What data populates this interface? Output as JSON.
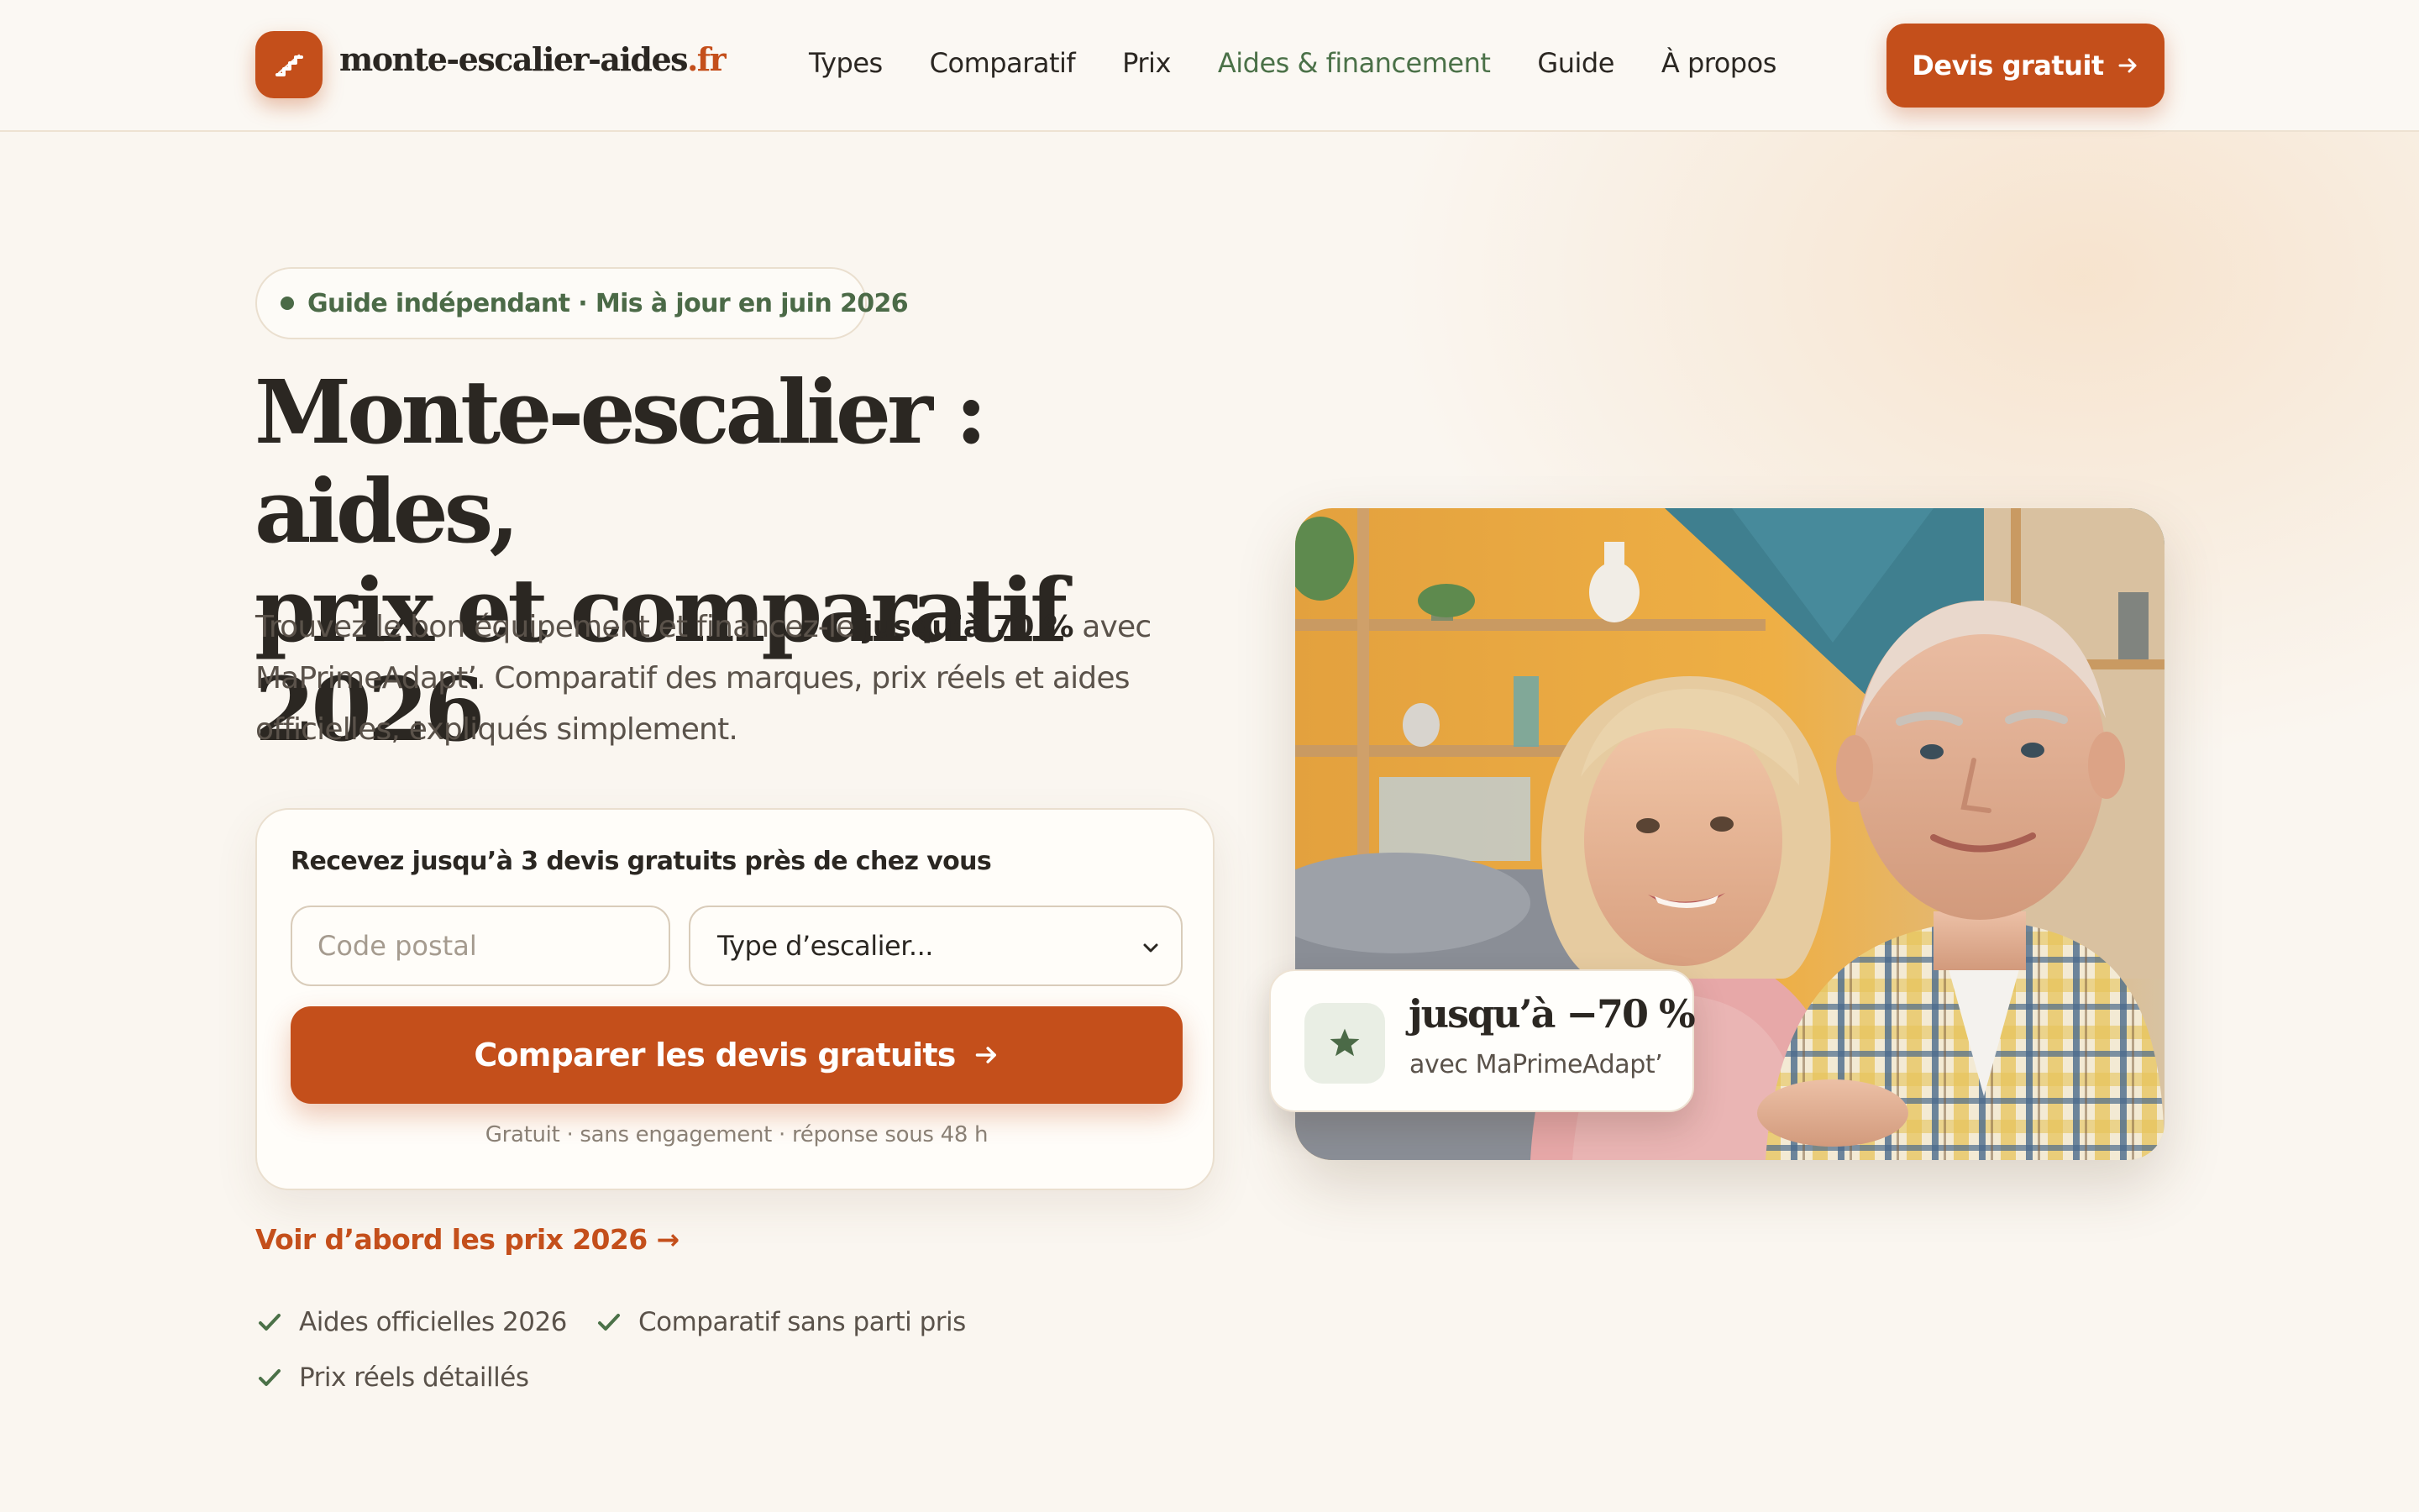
{
  "header": {
    "logo_main": "monte-escalier-aides",
    "logo_tld": ".fr",
    "nav": [
      {
        "label": "Types",
        "active": false
      },
      {
        "label": "Comparatif",
        "active": false
      },
      {
        "label": "Prix",
        "active": false
      },
      {
        "label": "Aides & financement",
        "active": true
      },
      {
        "label": "Guide",
        "active": false
      },
      {
        "label": "À propos",
        "active": false
      }
    ],
    "cta_label": "Devis gratuit"
  },
  "hero": {
    "badge": "Guide indépendant · Mis à jour en juin 2026",
    "title_line1": "Monte-escalier : aides,",
    "title_line2": "prix et comparatif 2026",
    "lead_before": "Trouvez le bon équipement et financez-le ",
    "lead_bold": "jusqu’à 70 %",
    "lead_after": " avec MaPrimeAdapt’. Comparatif des marques, prix réels et aides officielles, expliqués simplement."
  },
  "form": {
    "title": "Recevez jusqu’à 3 devis gratuits près de chez vous",
    "postal_placeholder": "Code postal",
    "select_value": "Type d’escalier...",
    "submit_label": "Comparer les devis gratuits",
    "note": "Gratuit · sans engagement · réponse sous 48 h"
  },
  "links": {
    "prices": "Voir d’abord les prix 2026 →"
  },
  "checks": [
    "Aides officielles 2026",
    "Comparatif sans parti pris",
    "Prix réels détaillés"
  ],
  "stat": {
    "value": "jusqu’à −70 %",
    "label": "avec MaPrimeAdapt’"
  },
  "colors": {
    "accent": "#c44f1b",
    "green": "#4b7148",
    "background": "#faf6f0",
    "text": "#2b2722"
  }
}
